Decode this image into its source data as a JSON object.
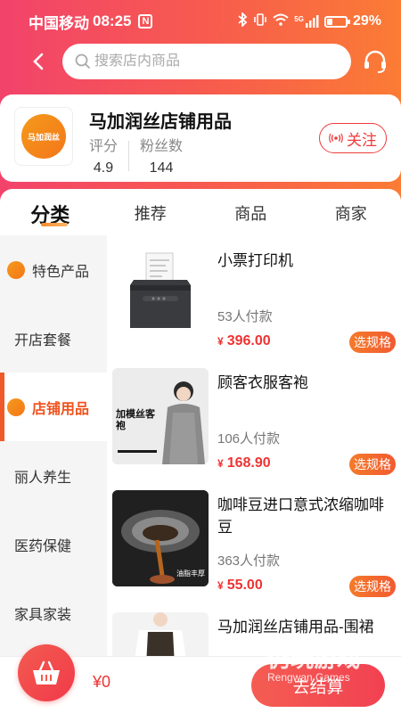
{
  "status_bar": {
    "carrier": "中国移动",
    "time": "08:25",
    "nfc": "N",
    "network": "5G",
    "battery_percent": "29%",
    "battery_level": 0.29
  },
  "search": {
    "placeholder": "搜索店内商品"
  },
  "shop": {
    "name": "马加润丝店铺用品",
    "logo_text": "马加润丝",
    "rating_label": "评分",
    "rating_value": "4.9",
    "fans_label": "粉丝数",
    "fans_value": "144",
    "follow_label": "关注"
  },
  "tabs": [
    {
      "label": "分类",
      "active": true
    },
    {
      "label": "推荐",
      "active": false
    },
    {
      "label": "商品",
      "active": false
    },
    {
      "label": "商家",
      "active": false
    }
  ],
  "categories": [
    {
      "label": "特色产品",
      "has_icon": true,
      "active": false
    },
    {
      "label": "开店套餐",
      "has_icon": false,
      "active": false
    },
    {
      "label": "店铺用品",
      "has_icon": true,
      "active": true
    },
    {
      "label": "丽人养生",
      "has_icon": false,
      "active": false
    },
    {
      "label": "医药保健",
      "has_icon": false,
      "active": false
    },
    {
      "label": "家具家装",
      "has_icon": false,
      "active": false
    }
  ],
  "products": [
    {
      "name": "小票打印机",
      "sold": "53人付款",
      "currency": "¥",
      "price": "396.00",
      "spec_label": "选规格",
      "image": "receipt-printer"
    },
    {
      "name": "顾客衣服客袍",
      "sold": "106人付款",
      "currency": "¥",
      "price": "168.90",
      "spec_label": "选规格",
      "image": "customer-gown",
      "image_text": "加模丝客袍"
    },
    {
      "name": "咖啡豆进口意式浓缩咖啡豆",
      "sold": "363人付款",
      "currency": "¥",
      "price": "55.00",
      "spec_label": "选规格",
      "image": "espresso-coffee",
      "image_text": "油脂丰厚"
    },
    {
      "name": "马加润丝店铺用品-围裙",
      "sold": "",
      "currency": "",
      "price": "",
      "spec_label": "",
      "image": "apron"
    }
  ],
  "bottom": {
    "cart_total": "¥0",
    "checkout_label": "去结算"
  },
  "watermark": {
    "title": "仍玩游戏",
    "subtitle": "Rengwan Games"
  },
  "colors": {
    "accent": "#f05a28",
    "price": "#e33333",
    "header_start": "#f2436b",
    "header_end": "#fb7c34"
  }
}
